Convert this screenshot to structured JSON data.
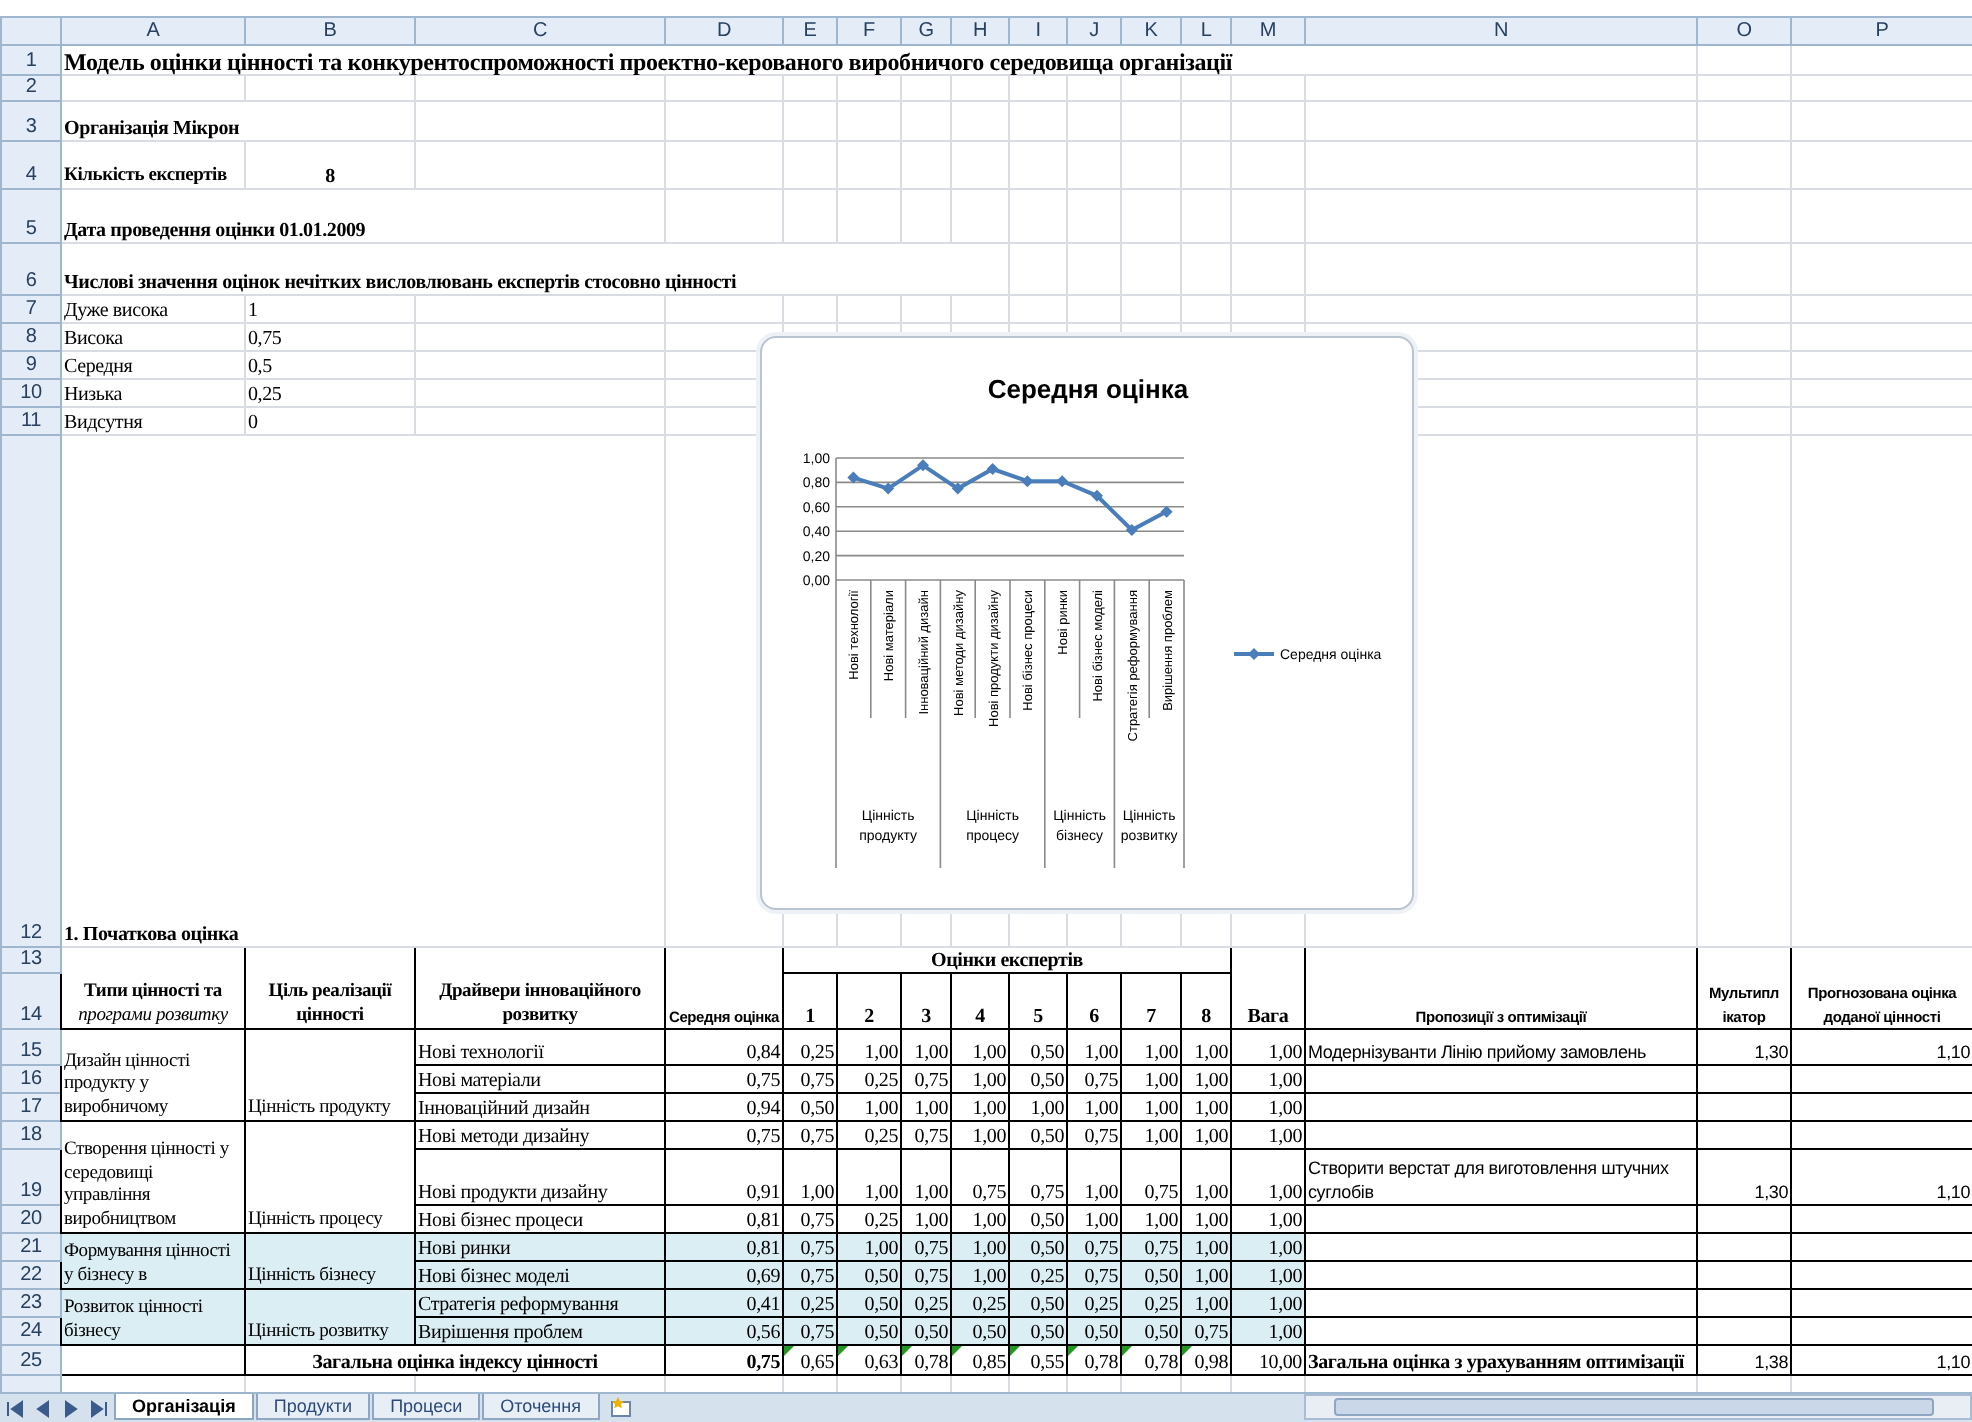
{
  "column_headers": [
    "A",
    "B",
    "C",
    "D",
    "E",
    "F",
    "G",
    "H",
    "I",
    "J",
    "K",
    "L",
    "M",
    "N",
    "O",
    "P"
  ],
  "row_numbers": [
    "1",
    "2",
    "3",
    "4",
    "5",
    "6",
    "7",
    "8",
    "9",
    "10",
    "11",
    "12",
    "13",
    "14",
    "15",
    "16",
    "17",
    "18",
    "19",
    "20",
    "21",
    "22",
    "23",
    "24",
    "25"
  ],
  "title": "Модель оцінки цінності  та конкурентоспроможності проектно-керованого виробничого середовища організації",
  "organization": "Організація Мікрон",
  "experts": {
    "label": "Кількість експертів",
    "value": "8"
  },
  "date": "Дата проведення оцінки 01.01.2009",
  "scale_heading": "Числові значення оцінок нечітких висловлювань експертів стосовно цінності",
  "scale": [
    {
      "label": "Дуже висока",
      "value": "1"
    },
    {
      "label": "Висока",
      "value": "0,75"
    },
    {
      "label": "Середня",
      "value": "0,5"
    },
    {
      "label": "Низька",
      "value": "0,25"
    },
    {
      "label": "Видсутня",
      "value": "0"
    }
  ],
  "chart": {
    "chart_data": {
      "type": "line",
      "title": "Середня оцінка",
      "categories": [
        "Нові технології",
        "Нові матеріали",
        "Інноваційний дизайн",
        "Нові методи дизайну",
        "Нові продукти дизайну",
        "Нові бізнес процеси",
        "Нові ринки",
        "Нові бізнес моделі",
        "Стратегія реформування",
        "Вирішення проблем"
      ],
      "grid": true,
      "series": [
        {
          "name": "Середня оцінка",
          "color": "#4a7ebb",
          "marker": "diamond",
          "values": [
            0.84,
            0.75,
            0.94,
            0.75,
            0.91,
            0.81,
            0.81,
            0.69,
            0.41,
            0.56
          ]
        }
      ],
      "ylim": [
        0,
        1
      ],
      "yticks": [
        {
          "value": 0,
          "label": "0,00"
        },
        {
          "value": 0.2,
          "label": "0,20"
        },
        {
          "value": 0.4,
          "label": "0,40"
        },
        {
          "value": 0.6,
          "label": "0,60"
        },
        {
          "value": 0.8,
          "label": "0,80"
        },
        {
          "value": 1,
          "label": "1,00"
        }
      ]
    },
    "category_groups": [
      "Цінність продукту",
      "Цінність процесу",
      "Цінність бізнесу",
      "Цінність розвитку"
    ]
  },
  "section_title": "1. Початкова оцінка",
  "table": {
    "header": {
      "type": "**Типи цінності та** *програми розвитку*",
      "goal": "Ціль реалізації цінності",
      "driver": "Драйвери інноваційного розвитку",
      "average": "Середня оцінка",
      "experts": "Оцінки експертів",
      "expert_numbers": [
        "1",
        "2",
        "3",
        "4",
        "5",
        "6",
        "7",
        "8"
      ],
      "weight": "Вага",
      "proposal": "Пропозиції з оптимізації",
      "multiplier": "Мультипл ікатор",
      "forecast": "Прогнозована оцінка доданої цінності"
    },
    "groups": [
      {
        "type": "Дизайн цінності продукту у виробничому",
        "goal": "Цінність продукту",
        "shaded": false,
        "rows": [
          {
            "driver": "Нові технології",
            "average": "0,84",
            "scores": [
              "0,25",
              "1,00",
              "1,00",
              "1,00",
              "0,50",
              "1,00",
              "1,00",
              "1,00"
            ],
            "weight": "1,00",
            "proposal": "Модернізуванти Лінію прийому замовлень",
            "multiplier": "1,30",
            "forecast": "1,10"
          },
          {
            "driver": "Нові матеріали",
            "average": "0,75",
            "scores": [
              "0,75",
              "0,25",
              "0,75",
              "1,00",
              "0,50",
              "0,75",
              "1,00",
              "1,00"
            ],
            "weight": "1,00"
          },
          {
            "driver": "Інноваційний дизайн",
            "average": "0,94",
            "scores": [
              "0,50",
              "1,00",
              "1,00",
              "1,00",
              "1,00",
              "1,00",
              "1,00",
              "1,00"
            ],
            "weight": "1,00"
          }
        ]
      },
      {
        "type": "Створення цінності у середовищі управління виробництвом",
        "goal": "Цінність процесу",
        "shaded": false,
        "rows": [
          {
            "driver": "Нові методи дизайну",
            "average": "0,75",
            "scores": [
              "0,75",
              "0,25",
              "0,75",
              "1,00",
              "0,50",
              "0,75",
              "1,00",
              "1,00"
            ],
            "weight": "1,00"
          },
          {
            "driver": "Нові продукти дизайну",
            "average": "0,91",
            "scores": [
              "1,00",
              "1,00",
              "1,00",
              "0,75",
              "0,75",
              "1,00",
              "0,75",
              "1,00"
            ],
            "weight": "1,00",
            "proposal": "Створити верстат для виготовлення штучних суглобів",
            "multiplier": "1,30",
            "forecast": "1,10"
          },
          {
            "driver": "Нові бізнес процеси",
            "average": "0,81",
            "scores": [
              "0,75",
              "0,25",
              "1,00",
              "1,00",
              "0,50",
              "1,00",
              "1,00",
              "1,00"
            ],
            "weight": "1,00"
          }
        ]
      },
      {
        "type": "Формування цінності у бізнесу в",
        "goal": "Цінність бізнесу",
        "shaded": true,
        "rows": [
          {
            "driver": "Нові ринки",
            "average": "0,81",
            "scores": [
              "0,75",
              "1,00",
              "0,75",
              "1,00",
              "0,50",
              "0,75",
              "0,75",
              "1,00"
            ],
            "weight": "1,00"
          },
          {
            "driver": "Нові бізнес моделі",
            "average": "0,69",
            "scores": [
              "0,75",
              "0,50",
              "0,75",
              "1,00",
              "0,25",
              "0,75",
              "0,50",
              "1,00"
            ],
            "weight": "1,00"
          }
        ]
      },
      {
        "type": "Розвиток цінності бізнесу",
        "goal": "Цінність розвитку",
        "shaded": true,
        "rows": [
          {
            "driver": "Стратегія реформування",
            "average": "0,41",
            "scores": [
              "0,25",
              "0,50",
              "0,25",
              "0,25",
              "0,50",
              "0,25",
              "0,25",
              "1,00"
            ],
            "weight": "1,00"
          },
          {
            "driver": "Вирішення проблем",
            "average": "0,56",
            "scores": [
              "0,75",
              "0,50",
              "0,50",
              "0,50",
              "0,50",
              "0,50",
              "0,50",
              "0,75"
            ],
            "weight": "1,00"
          }
        ]
      }
    ],
    "total": {
      "label": "Загальна оцінка індексу цінності",
      "average": "0,75",
      "scores": [
        {
          "value": "0,65",
          "flagged": true
        },
        {
          "value": "0,63",
          "flagged": true
        },
        {
          "value": "0,78",
          "flagged": true
        },
        {
          "value": "0,85",
          "flagged": true
        },
        {
          "value": "0,55",
          "flagged": true
        },
        {
          "value": "0,78",
          "flagged": true
        },
        {
          "value": "0,78",
          "flagged": true
        },
        {
          "value": "0,98",
          "flagged": true
        }
      ],
      "weight": "10,00",
      "optimized_label": "Загальна оцінка з урахуванням  оптимізації",
      "multiplier": "1,38",
      "forecast": "1,10"
    }
  },
  "sheet_tabs": [
    {
      "label": "Організація",
      "selected": true
    },
    {
      "label": "Продукти",
      "selected": false
    },
    {
      "label": "Процеси",
      "selected": false
    },
    {
      "label": "Оточення",
      "selected": false
    }
  ]
}
